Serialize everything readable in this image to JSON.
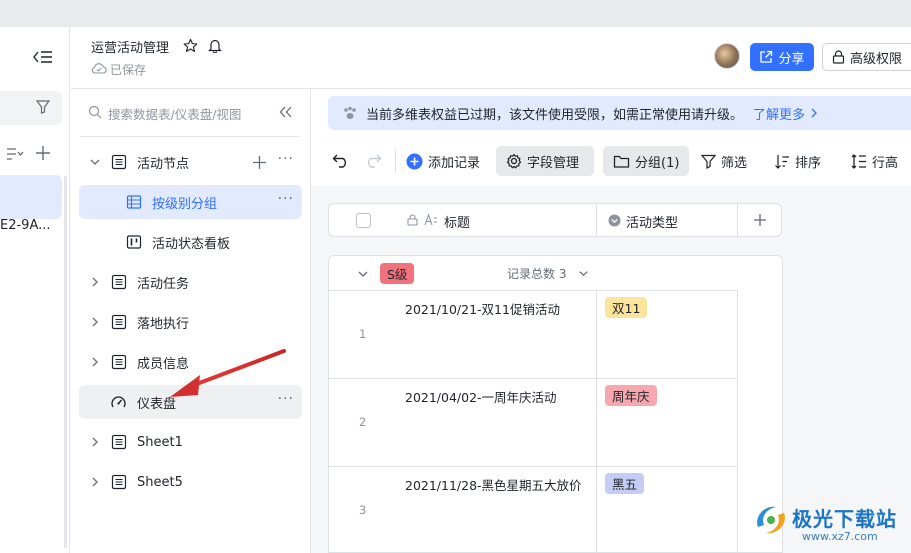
{
  "app": {
    "doc_title": "运营活动管理",
    "saved_text": "已保存",
    "share_label": "分享",
    "permission_label": "高级权限"
  },
  "left_strip": {
    "item_text": "E2-9A..."
  },
  "sidebar": {
    "search_placeholder": "搜索数据表/仪表盘/视图",
    "items": [
      {
        "label": "活动节点",
        "icon": "table-icon"
      },
      {
        "label": "按级别分组",
        "icon": "grid-view-icon"
      },
      {
        "label": "活动状态看板",
        "icon": "kanban-icon"
      },
      {
        "label": "活动任务",
        "icon": "table-icon"
      },
      {
        "label": "落地执行",
        "icon": "table-icon"
      },
      {
        "label": "成员信息",
        "icon": "table-icon"
      },
      {
        "label": "仪表盘",
        "icon": "dashboard-icon"
      },
      {
        "label": "Sheet1",
        "icon": "table-icon"
      },
      {
        "label": "Sheet5",
        "icon": "table-icon"
      }
    ]
  },
  "banner": {
    "text": "当前多维表权益已过期，该文件使用受限，如需正常使用请升级。",
    "link": "了解更多"
  },
  "toolbar": {
    "add_record": "添加记录",
    "field_manage": "字段管理",
    "group": "分组(1)",
    "filter": "筛选",
    "sort": "排序",
    "row_height": "行高"
  },
  "table": {
    "columns": [
      "标题",
      "活动类型"
    ],
    "group": {
      "name": "S级",
      "count_label": "记录总数 3"
    },
    "rows": [
      {
        "num": "1",
        "title": "2021/10/21-双11促销活动",
        "tag": "双11",
        "tag_color": "#fce49a"
      },
      {
        "num": "2",
        "title": "2021/04/02-一周年庆活动",
        "tag": "周年庆",
        "tag_color": "#f7a7ae"
      },
      {
        "num": "3",
        "title": "2021/11/28-黑色星期五大放价",
        "tag": "黑五",
        "tag_color": "#c5cdf7"
      }
    ]
  },
  "watermark": {
    "title": "极光下载站",
    "url": "www.xz7.com"
  },
  "colors": {
    "accent": "#3370ff",
    "selected": "#e1eaff",
    "group_tag": "#f0727c"
  }
}
